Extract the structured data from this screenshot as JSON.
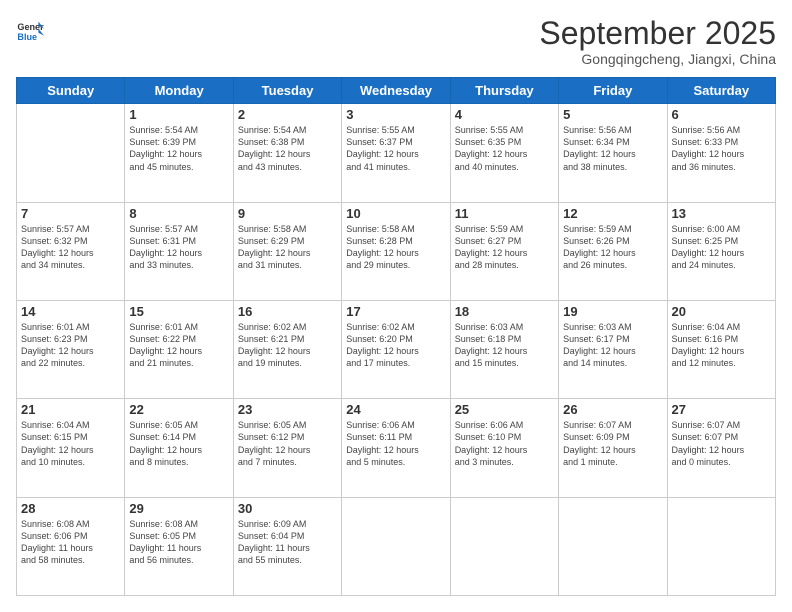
{
  "logo": {
    "line1": "General",
    "line2": "Blue"
  },
  "title": "September 2025",
  "location": "Gongqingcheng, Jiangxi, China",
  "weekdays": [
    "Sunday",
    "Monday",
    "Tuesday",
    "Wednesday",
    "Thursday",
    "Friday",
    "Saturday"
  ],
  "weeks": [
    [
      {
        "day": "",
        "info": ""
      },
      {
        "day": "1",
        "info": "Sunrise: 5:54 AM\nSunset: 6:39 PM\nDaylight: 12 hours\nand 45 minutes."
      },
      {
        "day": "2",
        "info": "Sunrise: 5:54 AM\nSunset: 6:38 PM\nDaylight: 12 hours\nand 43 minutes."
      },
      {
        "day": "3",
        "info": "Sunrise: 5:55 AM\nSunset: 6:37 PM\nDaylight: 12 hours\nand 41 minutes."
      },
      {
        "day": "4",
        "info": "Sunrise: 5:55 AM\nSunset: 6:35 PM\nDaylight: 12 hours\nand 40 minutes."
      },
      {
        "day": "5",
        "info": "Sunrise: 5:56 AM\nSunset: 6:34 PM\nDaylight: 12 hours\nand 38 minutes."
      },
      {
        "day": "6",
        "info": "Sunrise: 5:56 AM\nSunset: 6:33 PM\nDaylight: 12 hours\nand 36 minutes."
      }
    ],
    [
      {
        "day": "7",
        "info": "Sunrise: 5:57 AM\nSunset: 6:32 PM\nDaylight: 12 hours\nand 34 minutes."
      },
      {
        "day": "8",
        "info": "Sunrise: 5:57 AM\nSunset: 6:31 PM\nDaylight: 12 hours\nand 33 minutes."
      },
      {
        "day": "9",
        "info": "Sunrise: 5:58 AM\nSunset: 6:29 PM\nDaylight: 12 hours\nand 31 minutes."
      },
      {
        "day": "10",
        "info": "Sunrise: 5:58 AM\nSunset: 6:28 PM\nDaylight: 12 hours\nand 29 minutes."
      },
      {
        "day": "11",
        "info": "Sunrise: 5:59 AM\nSunset: 6:27 PM\nDaylight: 12 hours\nand 28 minutes."
      },
      {
        "day": "12",
        "info": "Sunrise: 5:59 AM\nSunset: 6:26 PM\nDaylight: 12 hours\nand 26 minutes."
      },
      {
        "day": "13",
        "info": "Sunrise: 6:00 AM\nSunset: 6:25 PM\nDaylight: 12 hours\nand 24 minutes."
      }
    ],
    [
      {
        "day": "14",
        "info": "Sunrise: 6:01 AM\nSunset: 6:23 PM\nDaylight: 12 hours\nand 22 minutes."
      },
      {
        "day": "15",
        "info": "Sunrise: 6:01 AM\nSunset: 6:22 PM\nDaylight: 12 hours\nand 21 minutes."
      },
      {
        "day": "16",
        "info": "Sunrise: 6:02 AM\nSunset: 6:21 PM\nDaylight: 12 hours\nand 19 minutes."
      },
      {
        "day": "17",
        "info": "Sunrise: 6:02 AM\nSunset: 6:20 PM\nDaylight: 12 hours\nand 17 minutes."
      },
      {
        "day": "18",
        "info": "Sunrise: 6:03 AM\nSunset: 6:18 PM\nDaylight: 12 hours\nand 15 minutes."
      },
      {
        "day": "19",
        "info": "Sunrise: 6:03 AM\nSunset: 6:17 PM\nDaylight: 12 hours\nand 14 minutes."
      },
      {
        "day": "20",
        "info": "Sunrise: 6:04 AM\nSunset: 6:16 PM\nDaylight: 12 hours\nand 12 minutes."
      }
    ],
    [
      {
        "day": "21",
        "info": "Sunrise: 6:04 AM\nSunset: 6:15 PM\nDaylight: 12 hours\nand 10 minutes."
      },
      {
        "day": "22",
        "info": "Sunrise: 6:05 AM\nSunset: 6:14 PM\nDaylight: 12 hours\nand 8 minutes."
      },
      {
        "day": "23",
        "info": "Sunrise: 6:05 AM\nSunset: 6:12 PM\nDaylight: 12 hours\nand 7 minutes."
      },
      {
        "day": "24",
        "info": "Sunrise: 6:06 AM\nSunset: 6:11 PM\nDaylight: 12 hours\nand 5 minutes."
      },
      {
        "day": "25",
        "info": "Sunrise: 6:06 AM\nSunset: 6:10 PM\nDaylight: 12 hours\nand 3 minutes."
      },
      {
        "day": "26",
        "info": "Sunrise: 6:07 AM\nSunset: 6:09 PM\nDaylight: 12 hours\nand 1 minute."
      },
      {
        "day": "27",
        "info": "Sunrise: 6:07 AM\nSunset: 6:07 PM\nDaylight: 12 hours\nand 0 minutes."
      }
    ],
    [
      {
        "day": "28",
        "info": "Sunrise: 6:08 AM\nSunset: 6:06 PM\nDaylight: 11 hours\nand 58 minutes."
      },
      {
        "day": "29",
        "info": "Sunrise: 6:08 AM\nSunset: 6:05 PM\nDaylight: 11 hours\nand 56 minutes."
      },
      {
        "day": "30",
        "info": "Sunrise: 6:09 AM\nSunset: 6:04 PM\nDaylight: 11 hours\nand 55 minutes."
      },
      {
        "day": "",
        "info": ""
      },
      {
        "day": "",
        "info": ""
      },
      {
        "day": "",
        "info": ""
      },
      {
        "day": "",
        "info": ""
      }
    ]
  ]
}
